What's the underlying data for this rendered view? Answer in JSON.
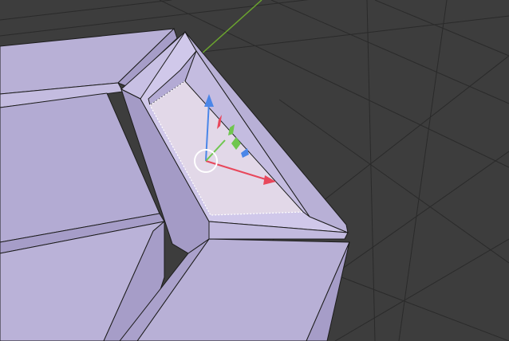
{
  "viewport": {
    "background": "#3d3d3d",
    "grid_color": "#2a2a2a",
    "y_axis_color": "#6ba42f"
  },
  "mesh": {
    "face_color": "#b8b0d6",
    "face_light": "#c9c1e6",
    "face_dark": "#a69dc8",
    "face_selected": "#e2d8e8",
    "edge_color": "#1c1c1c",
    "selected_edge_color": "#ffffff"
  },
  "gizmo": {
    "x_color": "#e8475b",
    "y_color": "#6fc64f",
    "z_color": "#4a86e8",
    "ring_color": "#ffffff"
  }
}
